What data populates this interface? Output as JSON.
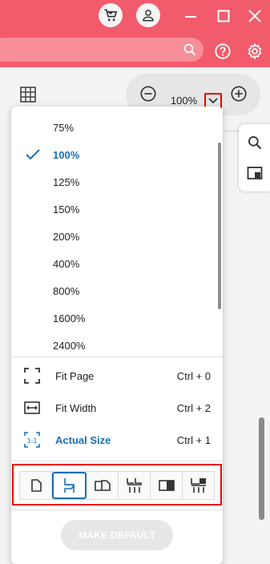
{
  "colors": {
    "titlebar": "#f25b6b",
    "accent": "#1a6fb5",
    "highlight": "#e00000"
  },
  "titlebar": {
    "icons": [
      "cart-icon",
      "user-icon",
      "minimize-icon",
      "maximize-icon",
      "close-icon"
    ],
    "search_placeholder": "",
    "help_icon": "help-icon",
    "settings_icon": "gear-icon"
  },
  "toolbar": {
    "grid_icon": "grid-icon",
    "zoom_value": "100%",
    "zoom_out_icon": "minus-circle-icon",
    "zoom_in_icon": "plus-circle-icon",
    "dropdown_icon": "chevron-down-icon"
  },
  "zoom_menu": {
    "options": [
      {
        "label": "75%",
        "selected": false
      },
      {
        "label": "100%",
        "selected": true
      },
      {
        "label": "125%",
        "selected": false
      },
      {
        "label": "150%",
        "selected": false
      },
      {
        "label": "200%",
        "selected": false
      },
      {
        "label": "400%",
        "selected": false
      },
      {
        "label": "800%",
        "selected": false
      },
      {
        "label": "1600%",
        "selected": false
      },
      {
        "label": "2400%",
        "selected": false
      }
    ],
    "fit_options": [
      {
        "label": "Fit Page",
        "shortcut": "Ctrl + 0",
        "icon": "fit-page-icon"
      },
      {
        "label": "Fit Width",
        "shortcut": "Ctrl + 2",
        "icon": "fit-width-icon"
      },
      {
        "label": "Actual Size",
        "shortcut": "Ctrl + 1",
        "icon": "actual-size-icon"
      }
    ],
    "layout_icons": [
      "single-page-icon",
      "single-page-continuous-icon",
      "two-page-icon",
      "two-page-continuous-icon",
      "two-page-cover-icon",
      "two-page-cover-continuous-icon"
    ],
    "make_default": "MAKE DEFAULT"
  },
  "side_panel": {
    "icons": [
      "search-icon",
      "panel-icon"
    ]
  }
}
